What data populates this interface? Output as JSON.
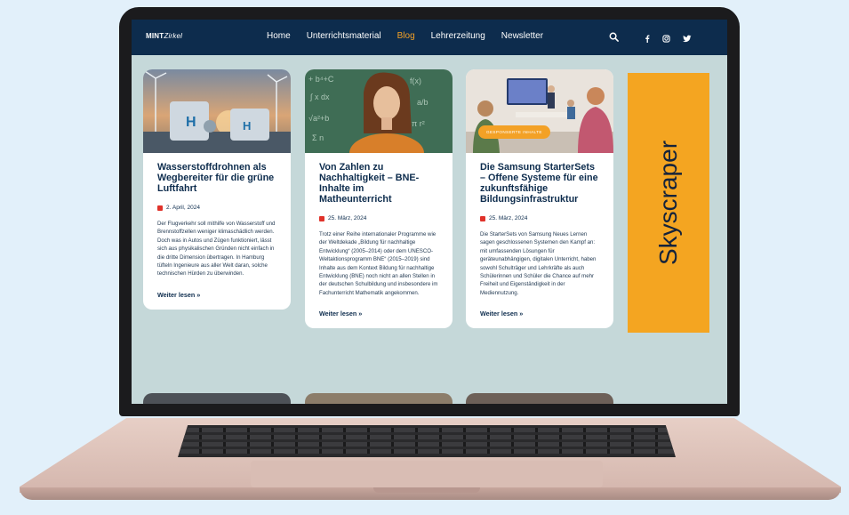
{
  "site": {
    "logo_bold": "MINT",
    "logo_light": "Zirkel",
    "nav": [
      "Home",
      "Unterrichtsmaterial",
      "Blog",
      "Lehrerzeitung",
      "Newsletter"
    ],
    "active_nav": "Blog",
    "icons": [
      "search-icon",
      "facebook-icon",
      "instagram-icon",
      "twitter-icon"
    ]
  },
  "colors": {
    "header_bg": "#0d2c4d",
    "accent": "#f3a126",
    "title": "#0d2c4d",
    "date_icon": "#e0322a",
    "page_bg": "#c5d8d9"
  },
  "cards": [
    {
      "title": "Wasserstoffdrohnen als Wegbereiter für die grüne Luftfahrt",
      "date": "2. April, 2024",
      "text": "Der Flugverkehr soll mithilfe von Wasserstoff und Brennstoffzellen weniger klimaschädlich werden. Doch was in Autos und Zügen funktioniert, lässt sich aus physikalischen Gründen nicht einfach in die dritte Dimension übertragen. In Hamburg tüfteln Ingenieure aus aller Welt daran, solche technischen Hürden zu überwinden.",
      "read_more": "Weiter lesen »"
    },
    {
      "title": "Von Zahlen zu Nachhaltigkeit – BNE-Inhalte im Matheunterricht",
      "date": "25. März, 2024",
      "text": "Trotz einer Reihe internationaler Programme wie der Weltdekade „Bildung für nachhaltige Entwicklung“ (2005–2014) oder dem UNESCO-Weltaktionsprogramm BNE“ (2015–2019) sind Inhalte aus dem Kontext Bildung für nachhaltige Entwicklung (BNE) noch nicht an allen Stellen in der deutschen Schulbildung und insbesondere im Fachunterricht Mathematik angekommen.",
      "read_more": "Weiter lesen »"
    },
    {
      "title": "Die Samsung StarterSets – Offene Systeme für eine zukunftsfähige Bildungsinfrastruktur",
      "date": "25. März, 2024",
      "badge": "GESPONSERTE INHALTE",
      "text": "Die StarterSets von Samsung Neues Lernen sagen geschlossenen Systemen den Kampf an: mit umfassenden Lösungen für geräteunabhängigen, digitalen Unterricht, haben sowohl Schulträger und Lehrkräfte als auch Schülerinnen und Schüler die Chance auf mehr Freiheit und Eigenständigkeit in der Mediennutzung.",
      "read_more": "Weiter lesen »"
    }
  ],
  "ad": {
    "label": "Skyscraper",
    "color": "#f4a521"
  }
}
